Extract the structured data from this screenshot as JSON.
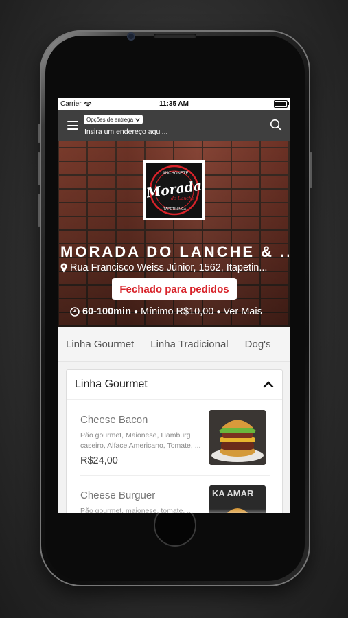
{
  "status_bar": {
    "carrier": "Carrier",
    "time": "11:35 AM"
  },
  "header": {
    "delivery_select": "Opções de entrega",
    "address_placeholder": "Insira um endereço aqui..."
  },
  "store": {
    "logo_text_top": "LANCHONETE",
    "logo_text_main": "Morada",
    "logo_text_sub": "do Lanche",
    "logo_text_bottom": "ITAPETININGA",
    "name": "MORADA DO LANCHE & ...",
    "address": "Rua Francisco Weiss Júnior, 1562, Itapetin...",
    "status_badge": "Fechado para pedidos",
    "delivery_time": "60-100min",
    "separator": "●",
    "minimum": "Mínimo R$10,00",
    "more": "Ver Mais"
  },
  "tabs": [
    "Linha Gourmet",
    "Linha Tradicional",
    "Dog's"
  ],
  "menu_section": {
    "title": "Linha Gourmet",
    "products": [
      {
        "name": "Cheese Bacon",
        "description": "Pão gourmet, Maionese, Hamburg caseiro, Alface Americano, Tomate, ...",
        "price": "R$24,00",
        "image_text": ""
      },
      {
        "name": "Cheese Burguer",
        "description": "Pão gourmet, maionese, tomate, ...",
        "price": "",
        "image_text": "KA AMAR"
      }
    ]
  },
  "colors": {
    "appbar": "#3f3f3f",
    "closed_text": "#d8232a",
    "logo_red": "#d8232a"
  }
}
